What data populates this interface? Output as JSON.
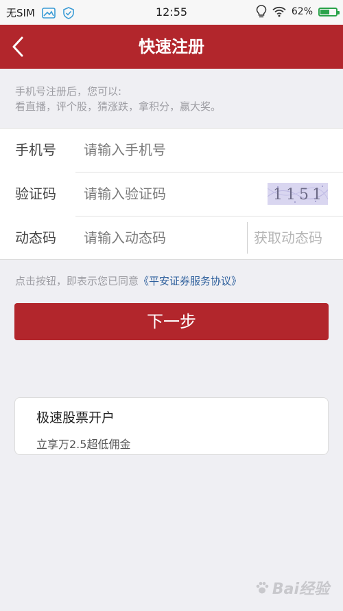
{
  "status_bar": {
    "carrier": "无SIM",
    "time": "12:55",
    "battery_percent": "62%",
    "battery_level": 0.62,
    "icons": [
      "image-icon",
      "shield-check-icon",
      "bulb-icon",
      "wifi-icon",
      "battery-icon"
    ]
  },
  "nav": {
    "title": "快速注册",
    "back_icon": "chevron-left-icon"
  },
  "intro": {
    "line1": "手机号注册后，您可以:",
    "line2": "看直播，评个股，猜涨跌，拿积分，赢大奖。"
  },
  "form": {
    "phone": {
      "label": "手机号",
      "placeholder": "请输入手机号",
      "value": ""
    },
    "captcha": {
      "label": "验证码",
      "placeholder": "请输入验证码",
      "value": "",
      "image_text": "1151"
    },
    "sms": {
      "label": "动态码",
      "placeholder": "请输入动态码",
      "value": "",
      "get_code_label": "获取动态码"
    }
  },
  "agreement": {
    "prefix": "点击按钮，即表示您已同意",
    "link": "《平安证券服务协议》"
  },
  "next_button": {
    "label": "下一步"
  },
  "promo_card": {
    "title": "极速股票开户",
    "subtitle": "立享万2.5超低佣金"
  },
  "watermark": {
    "text": "Bai经验"
  },
  "colors": {
    "brand_red": "#b2262c",
    "background": "#efeff3",
    "link_blue": "#2d5f9c",
    "battery_green": "#2aa34a"
  }
}
